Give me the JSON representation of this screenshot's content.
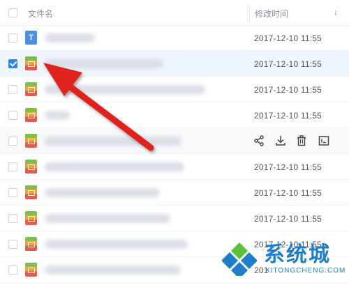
{
  "header": {
    "name_label": "文件名",
    "time_label": "修改时间",
    "sort_icon": "arrow-down-icon"
  },
  "rows": [
    {
      "icon": "doc-icon",
      "icon_letter": "T",
      "time": "2017-12-10 11:55",
      "selected": false
    },
    {
      "icon": "video-file-icon",
      "time": "2017-12-10 11:55",
      "selected": true
    },
    {
      "icon": "video-file-icon",
      "time": "2017-12-10 11:55",
      "selected": false
    },
    {
      "icon": "video-file-icon",
      "time": "2017-12-10 11:55",
      "selected": false
    },
    {
      "icon": "video-file-icon",
      "time": "",
      "selected": false,
      "hover": true
    },
    {
      "icon": "video-file-icon",
      "time": "2017-12-10 11:55",
      "selected": false
    },
    {
      "icon": "video-file-icon",
      "time": "2017-12-10 11:55",
      "selected": false
    },
    {
      "icon": "video-file-icon",
      "time": "2017-12-10 11:55",
      "selected": false
    },
    {
      "icon": "video-file-icon",
      "time": "2017-12-10 11:55",
      "selected": false
    },
    {
      "icon": "video-file-icon",
      "time": "201",
      "selected": false
    }
  ],
  "row_actions": [
    "share-icon",
    "download-icon",
    "delete-icon",
    "rename-icon"
  ],
  "annotation": {
    "color": "#e0201f"
  },
  "watermark": {
    "title": "系统城",
    "subtitle": "XITONGCHENG.COM",
    "colors": {
      "blue": "#1f7ec8",
      "green": "#5cbf3b"
    }
  }
}
